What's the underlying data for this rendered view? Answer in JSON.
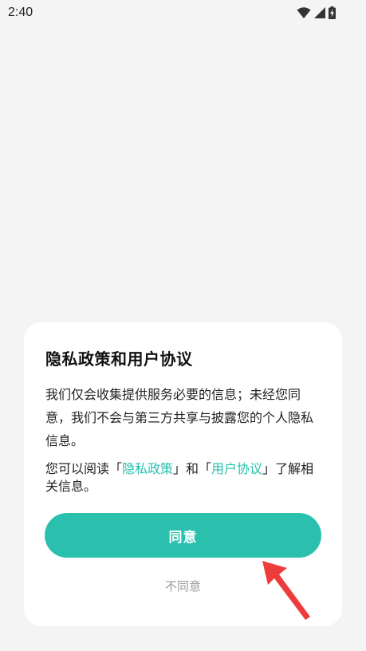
{
  "status_bar": {
    "time": "2:40",
    "icons": [
      "wifi-icon",
      "signal-icon",
      "battery-charging-icon"
    ]
  },
  "dialog": {
    "title": "隐私政策和用户协议",
    "body": "我们仅会收集提供服务必要的信息；未经您同意，我们不会与第三方共享与披露您的个人隐私信息。",
    "read_prefix": "您可以阅读「",
    "privacy_link": "隐私政策",
    "read_middle": "」和「",
    "agreement_link": "用户协议",
    "read_suffix": "」了解相关信息。",
    "agree_label": "同意",
    "disagree_label": "不同意"
  },
  "colors": {
    "accent": "#2bc0ae",
    "link": "#26bfae",
    "arrow": "#ee3b3b",
    "background": "#f4f4f4"
  }
}
